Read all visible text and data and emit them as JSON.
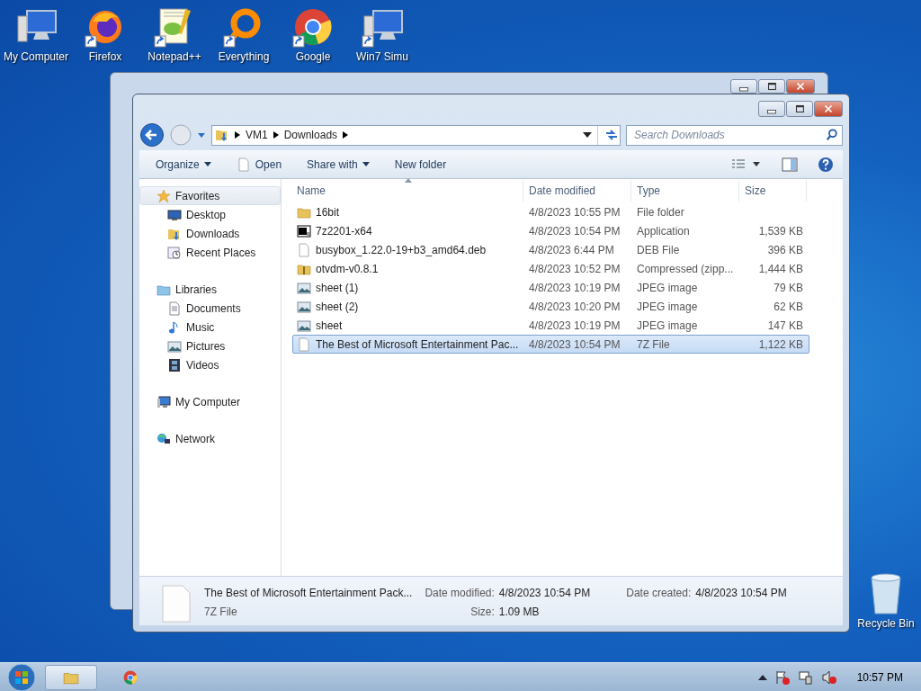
{
  "desktop_icons": [
    {
      "label": "My Computer",
      "kind": "computer",
      "shortcut": false
    },
    {
      "label": "Firefox",
      "kind": "firefox",
      "shortcut": true
    },
    {
      "label": "Notepad++",
      "kind": "notepad",
      "shortcut": true
    },
    {
      "label": "Everything",
      "kind": "everything",
      "shortcut": true
    },
    {
      "label": "Google",
      "kind": "chrome",
      "shortcut": true
    },
    {
      "label": "Win7 Simu",
      "kind": "computer",
      "shortcut": true
    }
  ],
  "recycle_bin": {
    "label": "Recycle Bin"
  },
  "window": {
    "address": [
      "VM1",
      "Downloads"
    ],
    "search": {
      "placeholder": "Search Downloads"
    },
    "toolbar": [
      {
        "label": "Organize",
        "kind": "menu"
      },
      {
        "label": "Open",
        "kind": "file"
      },
      {
        "label": "Share with",
        "kind": "menu"
      },
      {
        "label": "New folder",
        "kind": "plain"
      }
    ],
    "nav": [
      {
        "label": "Favorites",
        "kind": "star",
        "selected": true,
        "children": [
          {
            "label": "Desktop",
            "kind": "desktop",
            "selected": false
          },
          {
            "label": "Downloads",
            "kind": "downloads",
            "selected": false
          },
          {
            "label": "Recent Places",
            "kind": "recent",
            "selected": false
          }
        ]
      },
      {
        "label": "Libraries",
        "kind": "library",
        "selected": false,
        "children": [
          {
            "label": "Documents",
            "kind": "document",
            "selected": false
          },
          {
            "label": "Music",
            "kind": "music",
            "selected": false
          },
          {
            "label": "Pictures",
            "kind": "image",
            "selected": false
          },
          {
            "label": "Videos",
            "kind": "video",
            "selected": false
          }
        ]
      },
      {
        "label": "My Computer",
        "kind": "computer",
        "selected": false
      },
      {
        "label": "Network",
        "kind": "network",
        "selected": false
      }
    ],
    "table": {
      "columns": [
        {
          "label": "Name",
          "sorted": true
        },
        {
          "label": "Date modified",
          "sorted": false
        },
        {
          "label": "Type",
          "sorted": false
        },
        {
          "label": "Size",
          "sorted": false
        }
      ],
      "rows": [
        {
          "name": "16bit",
          "date": "4/8/2023 10:55 PM",
          "type": "File folder",
          "size": "",
          "kind": "folder",
          "selected": false
        },
        {
          "name": "7z2201-x64",
          "date": "4/8/2023 10:54 PM",
          "type": "Application",
          "size": "1,539 KB",
          "kind": "app",
          "selected": false
        },
        {
          "name": "busybox_1.22.0-19+b3_amd64.deb",
          "date": "4/8/2023 6:44 PM",
          "type": "DEB File",
          "size": "396 KB",
          "kind": "file",
          "selected": false
        },
        {
          "name": "otvdm-v0.8.1",
          "date": "4/8/2023 10:52 PM",
          "type": "Compressed (zipp...",
          "size": "1,444 KB",
          "kind": "zip",
          "selected": false
        },
        {
          "name": "sheet (1)",
          "date": "4/8/2023 10:19 PM",
          "type": "JPEG image",
          "size": "79 KB",
          "kind": "image",
          "selected": false
        },
        {
          "name": "sheet (2)",
          "date": "4/8/2023 10:20 PM",
          "type": "JPEG image",
          "size": "62 KB",
          "kind": "image",
          "selected": false
        },
        {
          "name": "sheet",
          "date": "4/8/2023 10:19 PM",
          "type": "JPEG image",
          "size": "147 KB",
          "kind": "image",
          "selected": false
        },
        {
          "name": "The Best of Microsoft Entertainment Pac...",
          "date": "4/8/2023 10:54 PM",
          "type": "7Z File",
          "size": "1,122 KB",
          "kind": "file",
          "selected": true
        }
      ]
    },
    "details": {
      "name": "The Best of Microsoft Entertainment Pack...",
      "type": "7Z File",
      "fields": [
        {
          "label": "Date modified:",
          "value": "4/8/2023 10:54 PM"
        },
        {
          "label": "Size:",
          "value": "1.09 MB"
        },
        {
          "label": "Date created:",
          "value": "4/8/2023 10:54 PM"
        }
      ]
    }
  },
  "taskbar": {
    "buttons": [
      {
        "kind": "explorer",
        "selected": true
      },
      {
        "kind": "chrome",
        "selected": false
      }
    ],
    "clock": "10:57 PM"
  }
}
